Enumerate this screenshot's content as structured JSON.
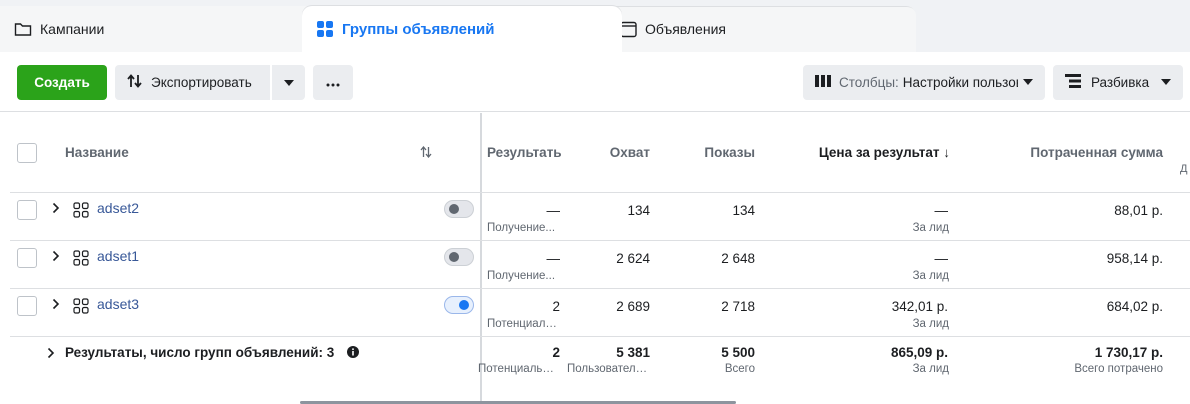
{
  "tabs": {
    "campaigns": "Кампании",
    "adsets": "Группы объявлений",
    "ads": "Объявления"
  },
  "toolbar": {
    "create": "Создать",
    "export": "Экспортировать",
    "columns_prefix": "Столбцы:",
    "columns_value": "Настройки пользователя",
    "breakdown": "Разбивка"
  },
  "table": {
    "headers": {
      "name": "Название",
      "results": "Результаты",
      "reach": "Охват",
      "impressions": "Показы",
      "cost_per_result": "Цена за результат ↓",
      "amount_spent": "Потраченная сумма",
      "overflow": "Д"
    },
    "rows": [
      {
        "name": "adset2",
        "toggle_on": false,
        "results": "—",
        "results_sub": "Получение...",
        "reach": "134",
        "impressions": "134",
        "cost": "—",
        "cost_sub": "За лид",
        "spent": "88,01 р."
      },
      {
        "name": "adset1",
        "toggle_on": false,
        "results": "—",
        "results_sub": "Получение...",
        "reach": "2 624",
        "impressions": "2 648",
        "cost": "—",
        "cost_sub": "За лид",
        "spent": "958,14 р."
      },
      {
        "name": "adset3",
        "toggle_on": true,
        "results": "2",
        "results_sub": "Потенциальные...",
        "reach": "2 689",
        "impressions": "2 718",
        "cost": "342,01 р.",
        "cost_sub": "За лид",
        "spent": "684,02 р."
      }
    ],
    "totals": {
      "label": "Результаты, число групп объявлений: 3",
      "results": "2",
      "results_sub": "Потенциальные...",
      "reach": "5 381",
      "reach_sub": "Пользователи...",
      "impressions": "5 500",
      "impressions_sub": "Всего",
      "cost": "865,09 р.",
      "cost_sub": "За лид",
      "spent": "1 730,17 р.",
      "spent_sub": "Всего потрачено"
    }
  },
  "colors": {
    "accent": "#1877f2",
    "create": "#2ba31a",
    "link": "#385898"
  }
}
